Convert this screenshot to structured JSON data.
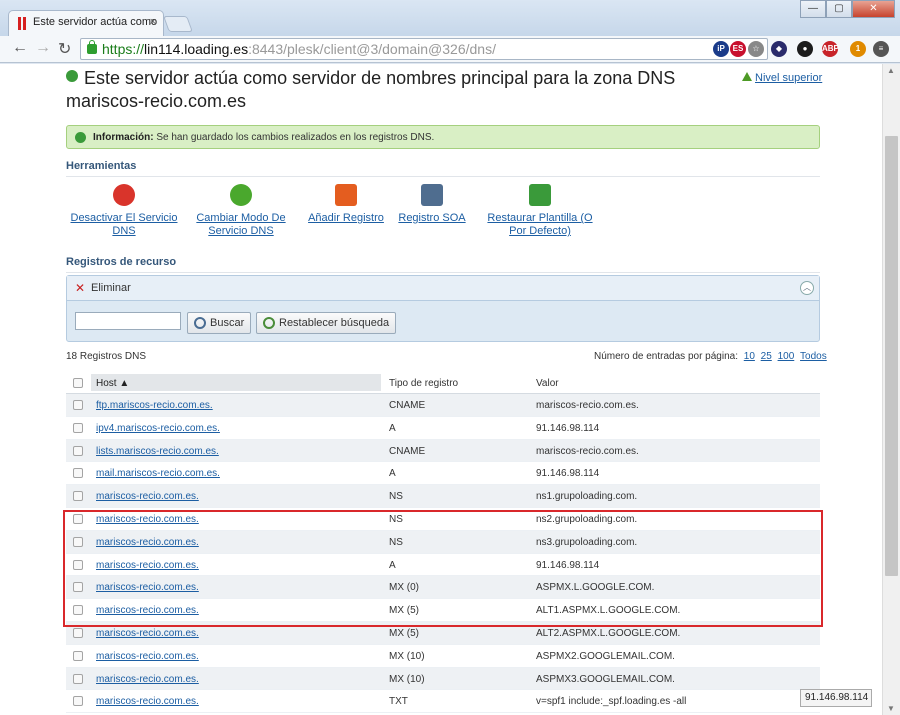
{
  "browser": {
    "tab_title": "Este servidor actúa como",
    "tab_close": "×",
    "window_buttons": [
      "—",
      "▢",
      "✕"
    ],
    "nav": {
      "back": "←",
      "forward": "→",
      "reload": "↻"
    },
    "url": {
      "scheme": "https://",
      "host": "lin114.loading.es",
      "path": ":8443/plesk/client@3/domain@326/dns/"
    },
    "extensions": [
      {
        "label": "iP",
        "color": "#1a3b8a"
      },
      {
        "label": "ES",
        "color": "#c8102e"
      },
      {
        "label": "☆",
        "color": "#888888"
      },
      {
        "label": "◆",
        "color": "#2a2b6b"
      },
      {
        "label": "●",
        "color": "#1d1d1d"
      },
      {
        "label": "ABP",
        "color": "#c8242a"
      },
      {
        "label": "1",
        "color": "#e08a00"
      },
      {
        "label": "≡",
        "color": "#555555"
      }
    ]
  },
  "page": {
    "title": "Este servidor actúa como servidor de nombres principal para la zona DNS mariscos-recio.com.es",
    "up_link": "Nivel superior",
    "message": {
      "label": "Información:",
      "text": " Se han guardado los cambios realizados en los registros DNS."
    },
    "tools_heading": "Herramientas",
    "tools": [
      {
        "label": "Desactivar El Servicio DNS",
        "icon": "power-icon",
        "color": "#d9342b"
      },
      {
        "label": "Cambiar Modo De Servicio DNS",
        "icon": "refresh-icon",
        "color": "#4aa82d"
      },
      {
        "label": "Añadir Registro",
        "icon": "flag-add-icon",
        "color": "#e45d1f"
      },
      {
        "label": "Registro SOA",
        "icon": "sliders-icon",
        "color": "#4f6d8f"
      },
      {
        "label": "Restaurar Plantilla (O Por Defecto)",
        "icon": "document-check-icon",
        "color": "#3a9a3a"
      }
    ],
    "records_heading": "Registros de recurso",
    "delete_label": "Eliminar",
    "search": {
      "value": "",
      "placeholder": "",
      "button": "Buscar",
      "reset": "Restablecer búsqueda"
    },
    "count": "18 Registros DNS",
    "per_page": {
      "label": "Número de entradas por página:",
      "options": [
        "10",
        "25",
        "100",
        "Todos"
      ]
    },
    "columns": {
      "host": "Host",
      "type": "Tipo de registro",
      "value": "Valor"
    },
    "rows": [
      {
        "host": "ftp.mariscos-recio.com.es.",
        "type": "CNAME",
        "value": "mariscos-recio.com.es."
      },
      {
        "host": "ipv4.mariscos-recio.com.es.",
        "type": "A",
        "value": "91.146.98.114"
      },
      {
        "host": "lists.mariscos-recio.com.es.",
        "type": "CNAME",
        "value": "mariscos-recio.com.es."
      },
      {
        "host": "mail.mariscos-recio.com.es.",
        "type": "A",
        "value": "91.146.98.114"
      },
      {
        "host": "mariscos-recio.com.es.",
        "type": "NS",
        "value": "ns1.grupoloading.com."
      },
      {
        "host": "mariscos-recio.com.es.",
        "type": "NS",
        "value": "ns2.grupoloading.com."
      },
      {
        "host": "mariscos-recio.com.es.",
        "type": "NS",
        "value": "ns3.grupoloading.com."
      },
      {
        "host": "mariscos-recio.com.es.",
        "type": "A",
        "value": "91.146.98.114"
      },
      {
        "host": "mariscos-recio.com.es.",
        "type": "MX (0)",
        "value": "ASPMX.L.GOOGLE.COM."
      },
      {
        "host": "mariscos-recio.com.es.",
        "type": "MX (5)",
        "value": "ALT1.ASPMX.L.GOOGLE.COM."
      },
      {
        "host": "mariscos-recio.com.es.",
        "type": "MX (5)",
        "value": "ALT2.ASPMX.L.GOOGLE.COM."
      },
      {
        "host": "mariscos-recio.com.es.",
        "type": "MX (10)",
        "value": "ASPMX2.GOOGLEMAIL.COM."
      },
      {
        "host": "mariscos-recio.com.es.",
        "type": "MX (10)",
        "value": "ASPMX3.GOOGLEMAIL.COM."
      },
      {
        "host": "mariscos-recio.com.es.",
        "type": "TXT",
        "value": "v=spf1 include:_spf.loading.es -all"
      }
    ],
    "status_text": "91.146.98.114"
  }
}
